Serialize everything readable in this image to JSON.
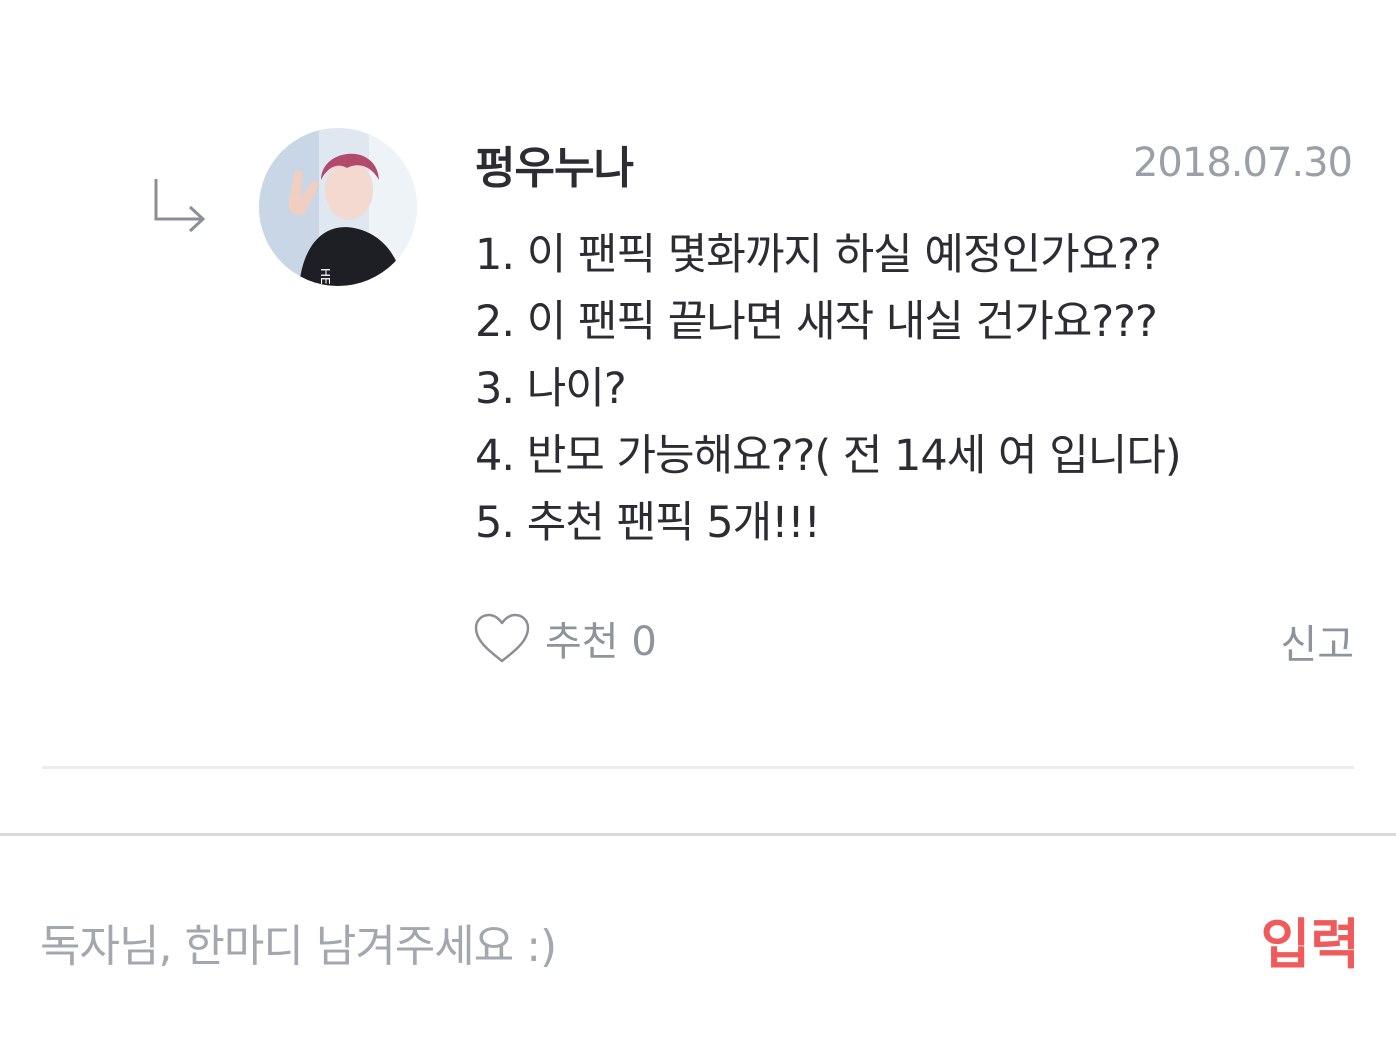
{
  "comment": {
    "author": "펑우누나",
    "date": "2018.07.30",
    "lines": [
      "1. 이 팬픽 몇화까지 하실 예정인가요??",
      "2. 이 팬픽 끝나면 새작 내실 건가요???",
      "3. 나이?",
      "4. 반모 가능해요??( 전 14세 여 입니다)",
      "5. 추천 팬픽 5개!!!"
    ],
    "like_label": "추천 0",
    "report_label": "신고"
  },
  "input": {
    "placeholder": "독자님, 한마디 남겨주세요 :)",
    "submit_label": "입력"
  },
  "colors": {
    "text": "#2b2d33",
    "muted": "#8e949c",
    "date": "#9aa0a8",
    "placeholder": "#a3a8ae",
    "accent": "#f05a5a",
    "divider": "#d6d9dd"
  },
  "icons": {
    "reply": "reply-arrow-icon",
    "like": "heart-outline-icon"
  }
}
